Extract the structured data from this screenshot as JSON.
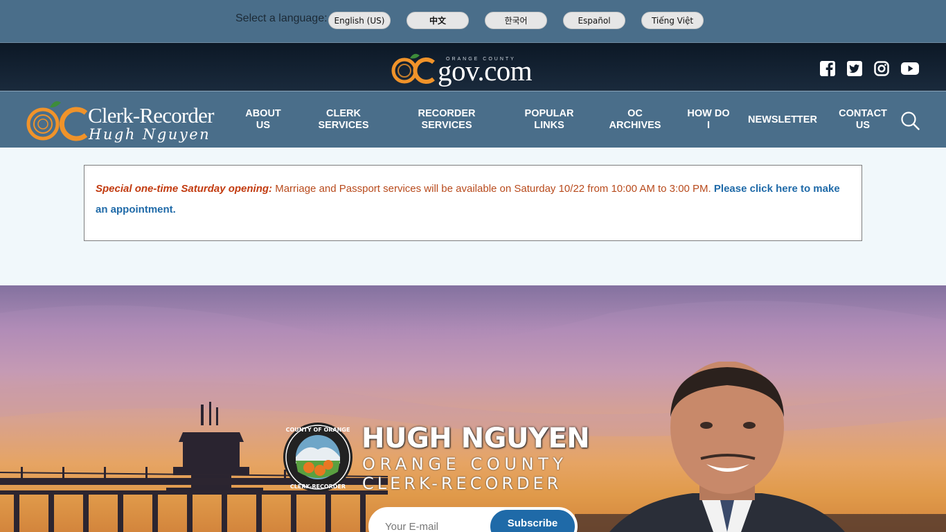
{
  "language_bar": {
    "label": "Select a language:",
    "languages": [
      "English (US)",
      "中文",
      "한국어",
      "Español",
      "Tiếng Việt"
    ],
    "selected": "English (US)"
  },
  "top_header": {
    "logo": {
      "text": "gov.com",
      "mark": "OC",
      "tagline": "ORANGE COUNTY"
    },
    "social_icons": [
      "facebook-icon",
      "twitter-icon",
      "instagram-icon",
      "youtube-icon"
    ]
  },
  "nav": {
    "brand": {
      "line1": "Clerk-Recorder",
      "line2": "Hugh Nguyen"
    },
    "items": [
      {
        "line1": "ABOUT",
        "line2": "US"
      },
      {
        "line1": "CLERK",
        "line2": "SERVICES"
      },
      {
        "line1": "RECORDER",
        "line2": "SERVICES"
      },
      {
        "line1": "POPULAR",
        "line2": "LINKS"
      },
      {
        "line1": "OC",
        "line2": "ARCHIVES"
      },
      {
        "line1": "HOW DO",
        "line2": "I"
      },
      {
        "line1": "NEWSLETTER",
        "line2": ""
      },
      {
        "line1": "CONTACT",
        "line2": "US"
      }
    ]
  },
  "alert": {
    "emphasis": "Special one-time Saturday opening:",
    "body": " Marriage and Passport services will be available on Saturday 10/22 from 10:00 AM to 3:00 PM. ",
    "link": "Please click here to make an appointment."
  },
  "hero": {
    "name": "HUGH NGUYEN",
    "subtitle1": "ORANGE COUNTY",
    "subtitle2": "CLERK-RECORDER",
    "seal": {
      "top": "COUNTY OF ORANGE",
      "bottom": "CLERK-RECORDER",
      "of": "OF"
    },
    "subscribe": {
      "placeholder": "Your E-mail",
      "button": "Subscribe"
    }
  },
  "colors": {
    "nav_bg": "#4a6e8a",
    "header_dark": "#0c1826",
    "orange": "#f0932a",
    "link_blue": "#1f6aa8",
    "alert_text": "#b84a1c"
  }
}
